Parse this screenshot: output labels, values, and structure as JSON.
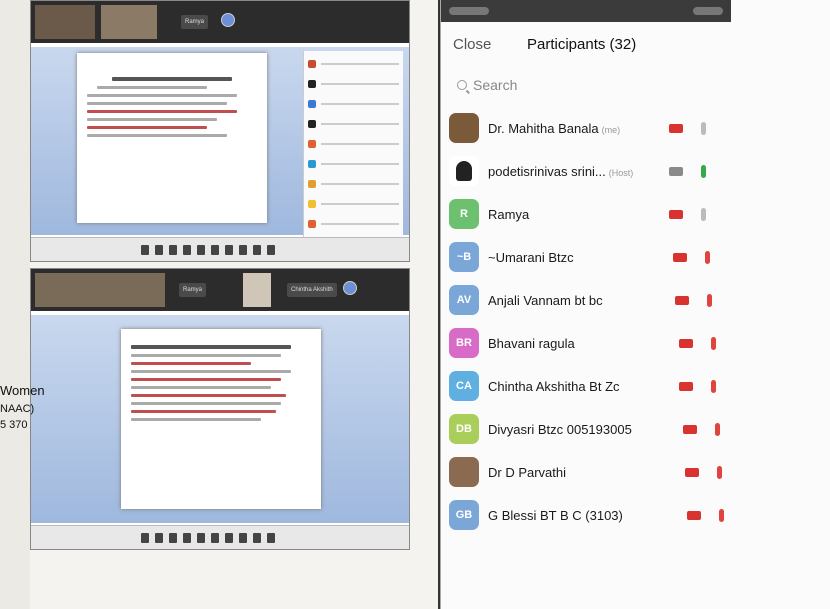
{
  "left": {
    "cut_text": [
      "Women",
      "NAAC)",
      "5 370"
    ],
    "shot1": {
      "name_pill": "Ramya"
    },
    "shot2": {
      "name_pills": [
        "Ramya",
        "Chintha Akshith"
      ]
    }
  },
  "participants_panel": {
    "close_label": "Close",
    "title": "Participants (32)",
    "search_placeholder": "Search",
    "participants": [
      {
        "name": "Dr. Mahitha Banala",
        "tag": "(me)",
        "initials": "",
        "avatar_color": "#7a5a3a",
        "cam_color": "#d9332f",
        "mic_color": "#bbbbbb"
      },
      {
        "name": "podetisrinivas srini...",
        "tag": "(Host)",
        "initials": "",
        "avatar_color": "#ffffff",
        "cam_color": "#8a8a8a",
        "mic_color": "#3aa84a"
      },
      {
        "name": "Ramya",
        "tag": "",
        "initials": "R",
        "avatar_color": "#6cc070",
        "cam_color": "#d9332f",
        "mic_color": "#bbbbbb"
      },
      {
        "name": "~Umarani Btzc",
        "tag": "",
        "initials": "~B",
        "avatar_color": "#7aa6d8",
        "cam_color": "#d9332f",
        "mic_color": "#e0443f"
      },
      {
        "name": "Anjali Vannam bt bc",
        "tag": "",
        "initials": "AV",
        "avatar_color": "#7aa6d8",
        "cam_color": "#d9332f",
        "mic_color": "#e0443f"
      },
      {
        "name": "Bhavani ragula",
        "tag": "",
        "initials": "BR",
        "avatar_color": "#d86bc8",
        "cam_color": "#d9332f",
        "mic_color": "#e0443f"
      },
      {
        "name": "Chintha Akshitha Bt Zc",
        "tag": "",
        "initials": "CA",
        "avatar_color": "#5fb0e0",
        "cam_color": "#d9332f",
        "mic_color": "#e0443f"
      },
      {
        "name": "Divyasri Btzc 005193005",
        "tag": "",
        "initials": "DB",
        "avatar_color": "#a9cf5a",
        "cam_color": "#d9332f",
        "mic_color": "#e0443f"
      },
      {
        "name": "Dr D Parvathi",
        "tag": "",
        "initials": "",
        "avatar_color": "#8a6a50",
        "cam_color": "#d9332f",
        "mic_color": "#e0443f"
      },
      {
        "name": "G Blessi BT B C (3103)",
        "tag": "",
        "initials": "GB",
        "avatar_color": "#7aa6d8",
        "cam_color": "#d9332f",
        "mic_color": "#e0443f"
      }
    ]
  }
}
